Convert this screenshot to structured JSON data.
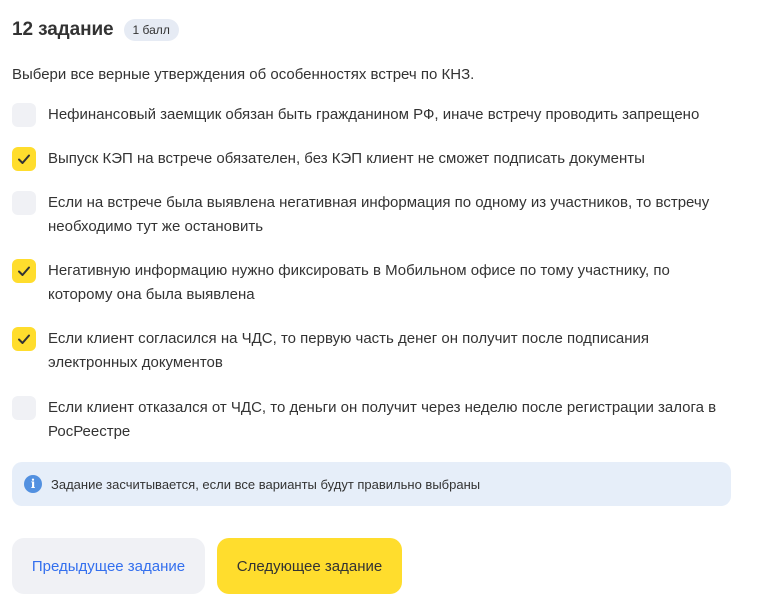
{
  "task": {
    "title": "12 задание",
    "points_badge": "1 балл"
  },
  "instruction": "Выбери все верные утверждения об особенностях встреч по КНЗ.",
  "options": [
    {
      "label": "Нефинансовый заемщик обязан быть гражданином РФ, иначе встречу проводить запрещено",
      "checked": false
    },
    {
      "label": "Выпуск КЭП на встрече обязателен, без КЭП клиент не сможет подписать документы",
      "checked": true
    },
    {
      "label": "Если на встрече была выявлена негативная информация по одному из участников, то встречу необходимо тут же остановить",
      "checked": false
    },
    {
      "label": "Негативную информацию нужно фиксировать в Мобильном офисе по тому участнику, по которому она была выявлена",
      "checked": true
    },
    {
      "label": "Если клиент согласился на ЧДС, то первую часть денег он получит после подписания электронных документов",
      "checked": true
    },
    {
      "label": "Если клиент отказался от ЧДС, то деньги он получит через неделю после регистрации залога в РосРеестре",
      "checked": false
    }
  ],
  "info": {
    "icon": "info-icon",
    "text": "Задание засчитывается, если все варианты будут правильно выбраны"
  },
  "buttons": {
    "prev_label": "Предыдущее задание",
    "next_label": "Следующее задание"
  },
  "colors": {
    "accent_yellow": "#ffdd2d",
    "link_blue": "#336fee",
    "checkbox_unchecked": "#f0f1f5",
    "info_background": "#e6eef9",
    "info_icon": "#5290e0"
  }
}
